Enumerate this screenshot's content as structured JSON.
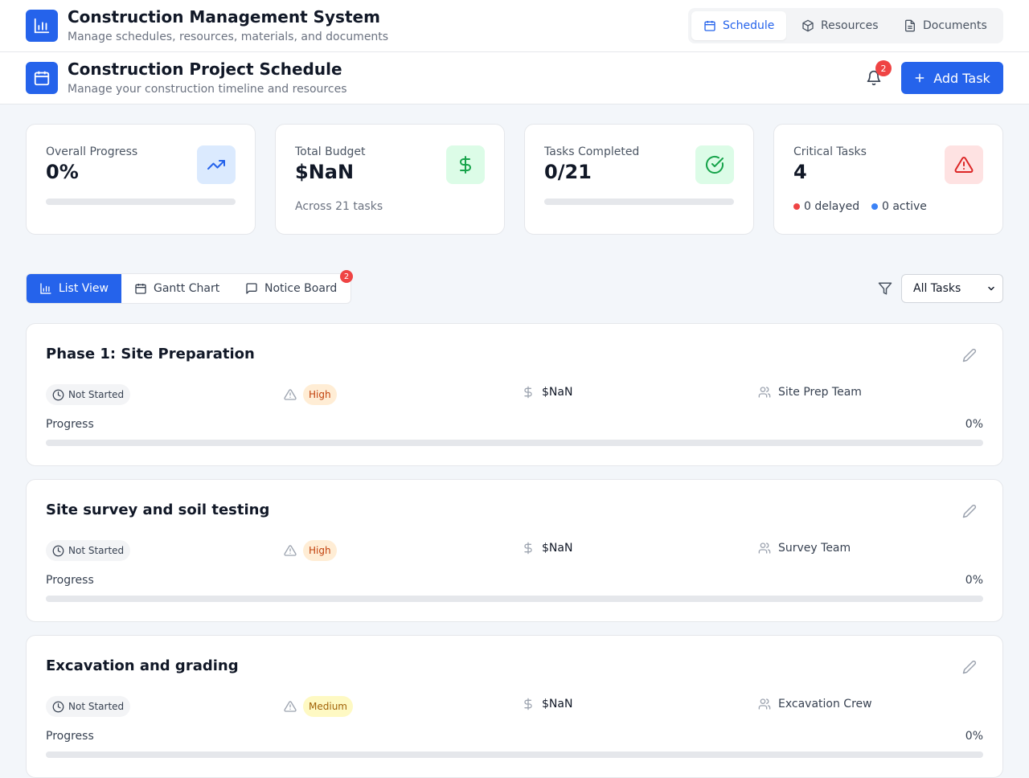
{
  "app": {
    "title": "Construction Management System",
    "subtitle": "Manage schedules, resources, materials, and documents",
    "icon": "bar-chart-icon"
  },
  "nav": [
    {
      "label": "Schedule",
      "icon": "calendar-icon",
      "active": true
    },
    {
      "label": "Resources",
      "icon": "box-icon",
      "active": false
    },
    {
      "label": "Documents",
      "icon": "document-icon",
      "active": false
    }
  ],
  "project": {
    "title": "Construction Project Schedule",
    "subtitle": "Manage your construction timeline and resources",
    "notification_count": "2",
    "add_task_label": "Add Task"
  },
  "stats": {
    "progress": {
      "label": "Overall Progress",
      "value": "0%",
      "fraction": 0,
      "icon": "trending-up-icon"
    },
    "budget": {
      "label": "Total Budget",
      "value": "$NaN",
      "note": "Across 21 tasks",
      "icon": "dollar-icon"
    },
    "completed": {
      "label": "Tasks Completed",
      "value": "0/21",
      "fraction": 0,
      "icon": "check-circle-icon"
    },
    "critical": {
      "label": "Critical Tasks",
      "value": "4",
      "delayed": "0 delayed",
      "active": "0 active",
      "icon": "warning-icon"
    }
  },
  "views": {
    "tabs": [
      {
        "label": "List View",
        "icon": "bar-chart-icon",
        "active": true
      },
      {
        "label": "Gantt Chart",
        "icon": "calendar-icon",
        "active": false
      },
      {
        "label": "Notice Board",
        "icon": "message-icon",
        "active": false
      }
    ],
    "notice_count": "2",
    "filter_value": "All Tasks"
  },
  "colors": {
    "accent": "#2563eb",
    "high_bg": "#ffedd5",
    "high_text": "#c2410c",
    "medium_bg": "#fef9c3",
    "medium_text": "#a16207",
    "danger": "#ef4444"
  },
  "tasks": [
    {
      "title": "Phase 1: Site Preparation",
      "status": "Not Started",
      "priority": "High",
      "cost": "$NaN",
      "team": "Site Prep Team",
      "progress_label": "Progress",
      "progress_text": "0%",
      "progress": 0
    },
    {
      "title": "Site survey and soil testing",
      "status": "Not Started",
      "priority": "High",
      "cost": "$NaN",
      "team": "Survey Team",
      "progress_label": "Progress",
      "progress_text": "0%",
      "progress": 0
    },
    {
      "title": "Excavation and grading",
      "status": "Not Started",
      "priority": "Medium",
      "cost": "$NaN",
      "team": "Excavation Crew",
      "progress_label": "Progress",
      "progress_text": "0%",
      "progress": 0
    }
  ]
}
